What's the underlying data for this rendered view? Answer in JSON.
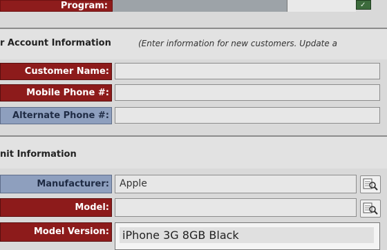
{
  "program": {
    "label": "Program:"
  },
  "account": {
    "title": "r Account Information",
    "note": "(Enter information for new customers.  Update a"
  },
  "fields": {
    "customer_name": {
      "label": "Customer Name:",
      "value": ""
    },
    "mobile_phone": {
      "label": "Mobile Phone #:",
      "value": ""
    },
    "alternate_phone": {
      "label": "Alternate Phone #:",
      "value": ""
    }
  },
  "unit": {
    "title": "nit Information"
  },
  "unit_fields": {
    "manufacturer": {
      "label": "Manufacturer:",
      "value": "Apple"
    },
    "model": {
      "label": "Model:",
      "value": ""
    },
    "model_version": {
      "label": "Model Version:",
      "selected": "iPhone 3G 8GB Black"
    }
  },
  "icons": {
    "lookup": "search-list-icon",
    "confirm": "check-icon"
  },
  "colors": {
    "label_red": "#8d1b1b",
    "label_blue": "#8e9fbe",
    "section_bg": "#e2e2e2"
  }
}
